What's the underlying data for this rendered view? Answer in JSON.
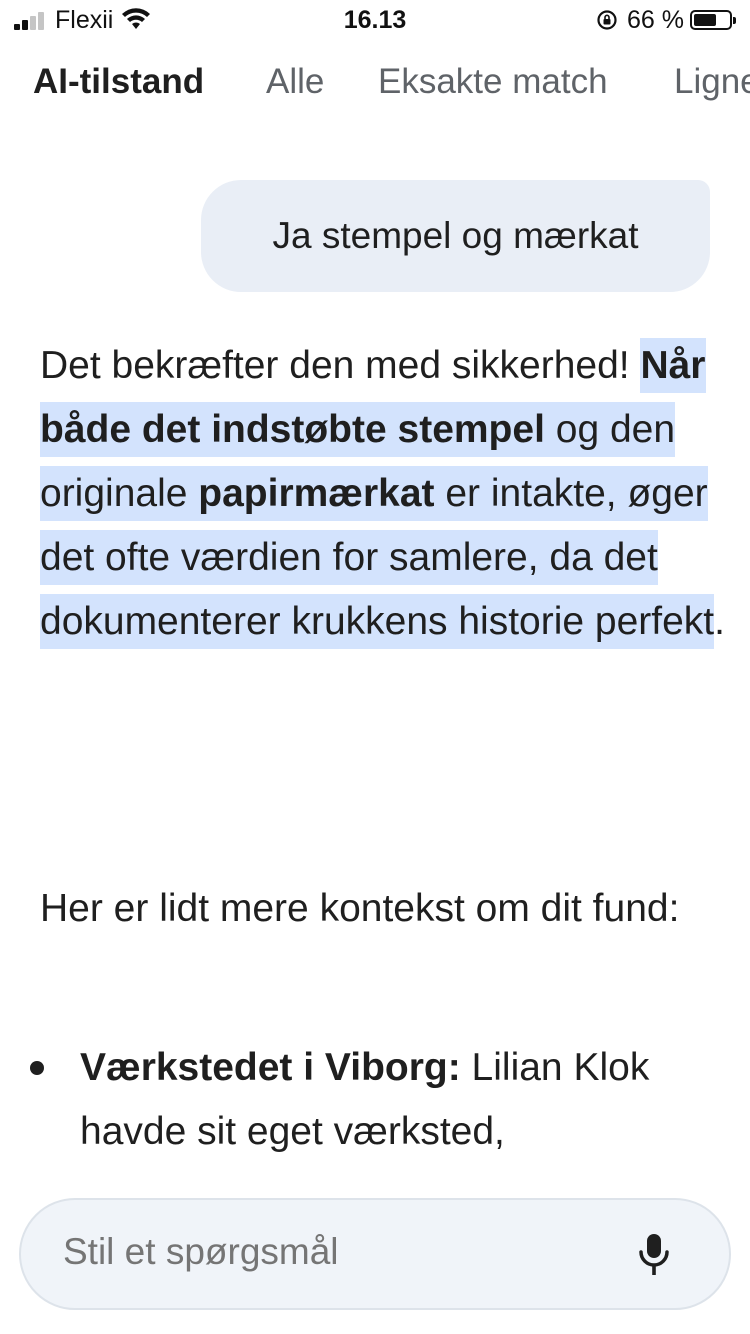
{
  "status_bar": {
    "carrier": "Flexii",
    "time": "16.13",
    "battery_percent": "66 %",
    "battery_level": 0.66,
    "signal_bars": 2
  },
  "tabs": [
    {
      "label": "AI-tilstand",
      "active": true
    },
    {
      "label": "Alle",
      "active": false
    },
    {
      "label": "Eksakte match",
      "active": false
    },
    {
      "label": "Ligne",
      "active": false
    }
  ],
  "user_message": "Ja stempel og mærkat",
  "answer": {
    "p1_plain": "Det bekræfter den med sikkerhed! ",
    "p1_hl_1": "Når både det indstøbte ",
    "p1_hl_b1": "stempel",
    "p1_hl_2": " og den originale ",
    "p1_hl_b2": "papirmærkat",
    "p1_hl_3": " er intakte, øger det ofte værdien for samlere, da det dokumenterer krukkens historie perfekt",
    "p1_end": ".",
    "p2": "Her er lidt mere kontekst om dit fund:",
    "bullet_title": "Værkstedet i Viborg:",
    "bullet_text": " Lilian Klok havde sit eget værksted,"
  },
  "input": {
    "placeholder": "Stil et spørgsmål"
  },
  "icons": {
    "signal": "signal-icon",
    "wifi": "wifi-icon",
    "orientation_lock": "orientation-lock-icon",
    "battery": "battery-icon",
    "mic": "mic-icon"
  },
  "colors": {
    "highlight": "#d3e3fd",
    "bubble": "#e9eef6",
    "input_bg": "#f0f4f9"
  }
}
